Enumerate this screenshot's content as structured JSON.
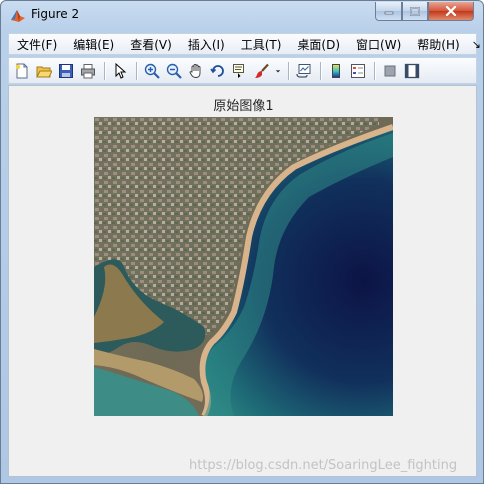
{
  "window": {
    "title": "Figure 2",
    "controls": {
      "minimize": "—",
      "maximize": "□",
      "close": "✕"
    }
  },
  "menu": {
    "items": [
      "文件(F)",
      "编辑(E)",
      "查看(V)",
      "插入(I)",
      "工具(T)",
      "桌面(D)",
      "窗口(W)",
      "帮助(H)"
    ],
    "overflow": "↘"
  },
  "toolbar": {
    "tools": [
      "new-figure-icon",
      "open-file-icon",
      "save-icon",
      "print-icon",
      "pointer-icon",
      "zoom-in-icon",
      "zoom-out-icon",
      "pan-hand-icon",
      "rotate-3d-icon",
      "data-cursor-icon",
      "brush-icon",
      "link-plot-icon",
      "colorbar-icon",
      "legend-icon",
      "hide-plot-tools-icon",
      "show-plot-tools-icon"
    ]
  },
  "figure": {
    "title": "原始图像1",
    "image_description_icon": "aerial-coastline-image"
  },
  "watermark": "https://blog.csdn.net/SoaringLee_fighting",
  "colors": {
    "sea_deep": "#0f1f4a",
    "sea_shallow": "#2f8c86",
    "land": "#7a6a55",
    "beach": "#d8b48a"
  }
}
